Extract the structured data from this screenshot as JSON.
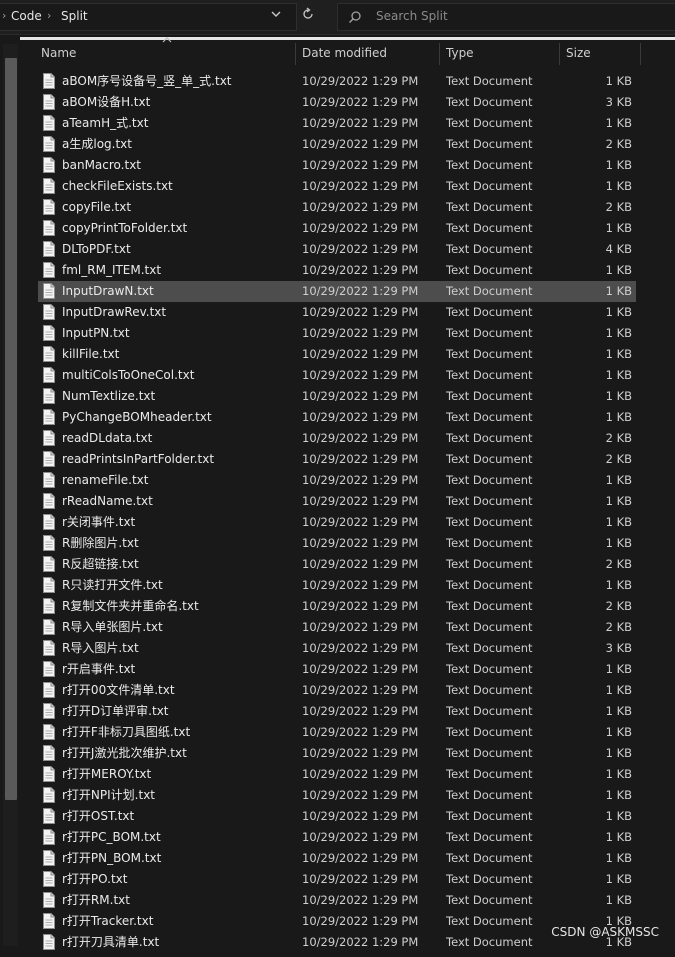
{
  "breadcrumb": {
    "part1": "Code",
    "part2": "Split"
  },
  "search": {
    "placeholder": "Search Split"
  },
  "columns": {
    "name": "Name",
    "date": "Date modified",
    "type": "Type",
    "size": "Size"
  },
  "files": [
    {
      "name": "aBOM序号设备号_竖_单_式.txt",
      "date": "10/29/2022 1:29 PM",
      "type": "Text Document",
      "size": "1 KB"
    },
    {
      "name": "aBOM设备H.txt",
      "date": "10/29/2022 1:29 PM",
      "type": "Text Document",
      "size": "3 KB"
    },
    {
      "name": "aTeamH_式.txt",
      "date": "10/29/2022 1:29 PM",
      "type": "Text Document",
      "size": "1 KB"
    },
    {
      "name": "a生成log.txt",
      "date": "10/29/2022 1:29 PM",
      "type": "Text Document",
      "size": "2 KB"
    },
    {
      "name": "banMacro.txt",
      "date": "10/29/2022 1:29 PM",
      "type": "Text Document",
      "size": "1 KB"
    },
    {
      "name": "checkFileExists.txt",
      "date": "10/29/2022 1:29 PM",
      "type": "Text Document",
      "size": "1 KB"
    },
    {
      "name": "copyFile.txt",
      "date": "10/29/2022 1:29 PM",
      "type": "Text Document",
      "size": "2 KB"
    },
    {
      "name": "copyPrintToFolder.txt",
      "date": "10/29/2022 1:29 PM",
      "type": "Text Document",
      "size": "1 KB"
    },
    {
      "name": "DLToPDF.txt",
      "date": "10/29/2022 1:29 PM",
      "type": "Text Document",
      "size": "4 KB"
    },
    {
      "name": "fml_RM_ITEM.txt",
      "date": "10/29/2022 1:29 PM",
      "type": "Text Document",
      "size": "1 KB"
    },
    {
      "name": "InputDrawN.txt",
      "date": "10/29/2022 1:29 PM",
      "type": "Text Document",
      "size": "1 KB",
      "selected": true
    },
    {
      "name": "InputDrawRev.txt",
      "date": "10/29/2022 1:29 PM",
      "type": "Text Document",
      "size": "1 KB"
    },
    {
      "name": "InputPN.txt",
      "date": "10/29/2022 1:29 PM",
      "type": "Text Document",
      "size": "1 KB"
    },
    {
      "name": "killFile.txt",
      "date": "10/29/2022 1:29 PM",
      "type": "Text Document",
      "size": "1 KB"
    },
    {
      "name": "multiColsToOneCol.txt",
      "date": "10/29/2022 1:29 PM",
      "type": "Text Document",
      "size": "1 KB"
    },
    {
      "name": "NumTextlize.txt",
      "date": "10/29/2022 1:29 PM",
      "type": "Text Document",
      "size": "1 KB"
    },
    {
      "name": "PyChangeBOMheader.txt",
      "date": "10/29/2022 1:29 PM",
      "type": "Text Document",
      "size": "1 KB"
    },
    {
      "name": "readDLdata.txt",
      "date": "10/29/2022 1:29 PM",
      "type": "Text Document",
      "size": "2 KB"
    },
    {
      "name": "readPrintsInPartFolder.txt",
      "date": "10/29/2022 1:29 PM",
      "type": "Text Document",
      "size": "2 KB"
    },
    {
      "name": "renameFile.txt",
      "date": "10/29/2022 1:29 PM",
      "type": "Text Document",
      "size": "1 KB"
    },
    {
      "name": "rReadName.txt",
      "date": "10/29/2022 1:29 PM",
      "type": "Text Document",
      "size": "1 KB"
    },
    {
      "name": "r关闭事件.txt",
      "date": "10/29/2022 1:29 PM",
      "type": "Text Document",
      "size": "1 KB"
    },
    {
      "name": "R删除图片.txt",
      "date": "10/29/2022 1:29 PM",
      "type": "Text Document",
      "size": "1 KB"
    },
    {
      "name": "R反超链接.txt",
      "date": "10/29/2022 1:29 PM",
      "type": "Text Document",
      "size": "2 KB"
    },
    {
      "name": "R只读打开文件.txt",
      "date": "10/29/2022 1:29 PM",
      "type": "Text Document",
      "size": "1 KB"
    },
    {
      "name": "R复制文件夹并重命名.txt",
      "date": "10/29/2022 1:29 PM",
      "type": "Text Document",
      "size": "2 KB"
    },
    {
      "name": "R导入单张图片.txt",
      "date": "10/29/2022 1:29 PM",
      "type": "Text Document",
      "size": "2 KB"
    },
    {
      "name": "R导入图片.txt",
      "date": "10/29/2022 1:29 PM",
      "type": "Text Document",
      "size": "3 KB"
    },
    {
      "name": "r开启事件.txt",
      "date": "10/29/2022 1:29 PM",
      "type": "Text Document",
      "size": "1 KB"
    },
    {
      "name": "r打开00文件清单.txt",
      "date": "10/29/2022 1:29 PM",
      "type": "Text Document",
      "size": "1 KB"
    },
    {
      "name": "r打开D订单评审.txt",
      "date": "10/29/2022 1:29 PM",
      "type": "Text Document",
      "size": "1 KB"
    },
    {
      "name": "r打开F非标刀具图纸.txt",
      "date": "10/29/2022 1:29 PM",
      "type": "Text Document",
      "size": "1 KB"
    },
    {
      "name": "r打开J激光批次维护.txt",
      "date": "10/29/2022 1:29 PM",
      "type": "Text Document",
      "size": "1 KB"
    },
    {
      "name": "r打开MEROY.txt",
      "date": "10/29/2022 1:29 PM",
      "type": "Text Document",
      "size": "1 KB"
    },
    {
      "name": "r打开NPI计划.txt",
      "date": "10/29/2022 1:29 PM",
      "type": "Text Document",
      "size": "1 KB"
    },
    {
      "name": "r打开OST.txt",
      "date": "10/29/2022 1:29 PM",
      "type": "Text Document",
      "size": "1 KB"
    },
    {
      "name": "r打开PC_BOM.txt",
      "date": "10/29/2022 1:29 PM",
      "type": "Text Document",
      "size": "1 KB"
    },
    {
      "name": "r打开PN_BOM.txt",
      "date": "10/29/2022 1:29 PM",
      "type": "Text Document",
      "size": "1 KB"
    },
    {
      "name": "r打开PO.txt",
      "date": "10/29/2022 1:29 PM",
      "type": "Text Document",
      "size": "1 KB"
    },
    {
      "name": "r打开RM.txt",
      "date": "10/29/2022 1:29 PM",
      "type": "Text Document",
      "size": "1 KB"
    },
    {
      "name": "r打开Tracker.txt",
      "date": "10/29/2022 1:29 PM",
      "type": "Text Document",
      "size": "1 KB"
    },
    {
      "name": "r打开刀具清单.txt",
      "date": "10/29/2022 1:29 PM",
      "type": "Text Document",
      "size": "1 KB"
    }
  ],
  "watermark": "CSDN @ASKMSSC",
  "colors": {
    "background": "#191919",
    "selected_row": "#4d4d4d",
    "text": "#eaeaea"
  }
}
